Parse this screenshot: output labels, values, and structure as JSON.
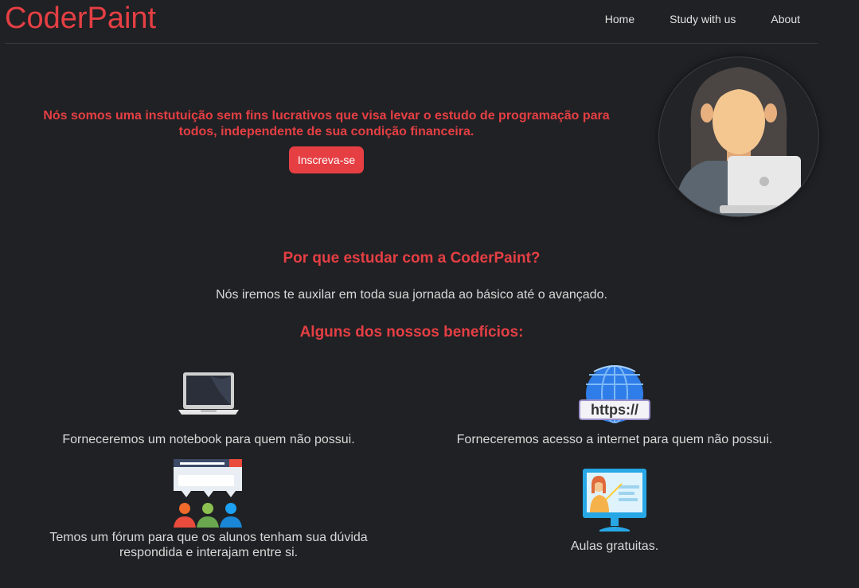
{
  "header": {
    "logo": "CoderPaint",
    "nav": [
      {
        "label": "Home"
      },
      {
        "label": "Study with us"
      },
      {
        "label": "About"
      }
    ]
  },
  "hero": {
    "text": "Nós somos uma instutuição sem fins lucrativos que visa levar o estudo de programação para todos, independente de sua condição financeira.",
    "cta_label": "Inscreva-se"
  },
  "why": {
    "title": "Por que estudar com a CoderPaint?",
    "text": "Nós iremos te auxilar em toda sua jornada ao básico até o avançado."
  },
  "benefits": {
    "title": "Alguns dos nossos benefícios:",
    "items": [
      {
        "text": "Forneceremos um notebook para quem não possui.",
        "icon": "laptop-icon"
      },
      {
        "text": "Forneceremos acesso a internet para quem não possui.",
        "icon": "globe-https-icon",
        "icon_label": "https://"
      },
      {
        "text": "Temos um fórum para que os alunos tenham sua dúvida respondida e interajam entre si.",
        "icon": "forum-icon"
      },
      {
        "text": "Aulas gratuitas.",
        "icon": "online-class-icon"
      }
    ]
  },
  "colors": {
    "accent": "#e53f44",
    "background": "#202124",
    "text": "#d8d8d8"
  }
}
